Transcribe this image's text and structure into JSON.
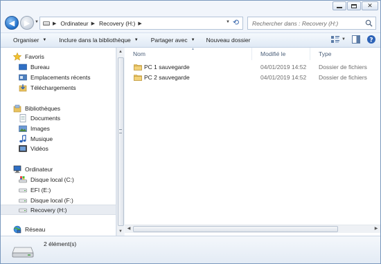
{
  "window": {
    "caption_buttons": [
      "minimize",
      "maximize",
      "close"
    ]
  },
  "address_bar": {
    "crumbs": [
      "Ordinateur",
      "Recovery (H:)"
    ],
    "search_placeholder": "Rechercher dans : Recovery (H:)"
  },
  "toolbar": {
    "organize": "Organiser",
    "include_library": "Inclure dans la bibliothèque",
    "share_with": "Partager avec",
    "new_folder": "Nouveau dossier"
  },
  "nav": {
    "favorites": "Favoris",
    "favorites_items": [
      "Bureau",
      "Emplacements récents",
      "Téléchargements"
    ],
    "libraries": "Bibliothèques",
    "libraries_items": [
      "Documents",
      "Images",
      "Musique",
      "Vidéos"
    ],
    "computer": "Ordinateur",
    "computer_items": [
      "Disque local (C:)",
      "EFI (E:)",
      "Disque local (F:)",
      "Recovery (H:)"
    ],
    "selected": "Recovery (H:)",
    "network": "Réseau"
  },
  "columns": {
    "name": "Nom",
    "modified": "Modifié le",
    "type": "Type"
  },
  "files": [
    {
      "name": "PC 1 sauvegarde",
      "modified": "04/01/2019 14:52",
      "type": "Dossier de fichiers"
    },
    {
      "name": "PC 2 sauvegarde",
      "modified": "04/01/2019 14:52",
      "type": "Dossier de fichiers"
    }
  ],
  "status": {
    "item_count": "2 élément(s)"
  },
  "colors": {
    "folder": "#e8c260",
    "accent": "#1d6dc8",
    "header_text": "#4c607a"
  }
}
